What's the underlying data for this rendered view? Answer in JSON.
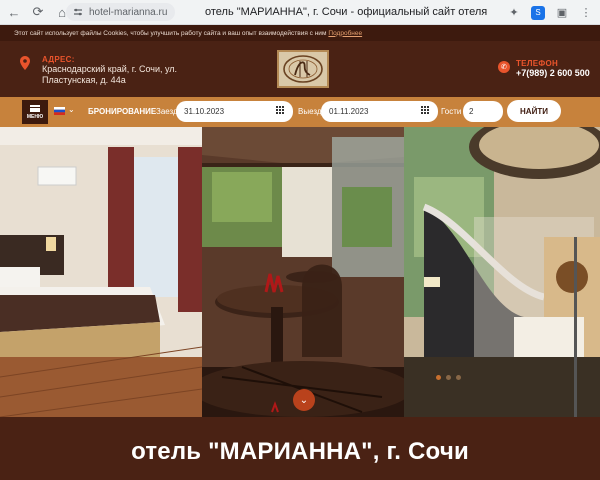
{
  "browser": {
    "url": "hotel-marianna.ru",
    "page_title": "отель \"МАРИАННА\", г. Сочи - официальный сайт отеля"
  },
  "cookie": {
    "text": "Этот сайт использует файлы Cookies, чтобы улучшить работу сайта и ваш опыт взаимодействия с ним",
    "link": "Подробнее"
  },
  "header": {
    "address_label": "АДРЕС:",
    "address_line1": "Краснодарский край, г. Сочи, ул.",
    "address_line2": "Пластунская, д. 44а",
    "phone_label": "ТЕЛЕФОН",
    "phone": "+7(989) 2 600 500"
  },
  "booking": {
    "menu_label": "МЕНЮ",
    "title": "БРОНИРОВАНИЕ",
    "checkin_label": "Заезд",
    "checkin_value": "31.10.2023",
    "checkout_label": "Выезд",
    "checkout_value": "01.11.2023",
    "guests_label": "Гости",
    "guests_value": "2",
    "search_button": "НАЙТИ"
  },
  "hero": {
    "title": "отель \"МАРИАННА\", г. Сочи",
    "slides_total": 3,
    "slide_active": 1
  },
  "colors": {
    "brown_dark": "#4a2214",
    "accent_orange": "#e9542c",
    "booking_bar": "#c7823c"
  }
}
